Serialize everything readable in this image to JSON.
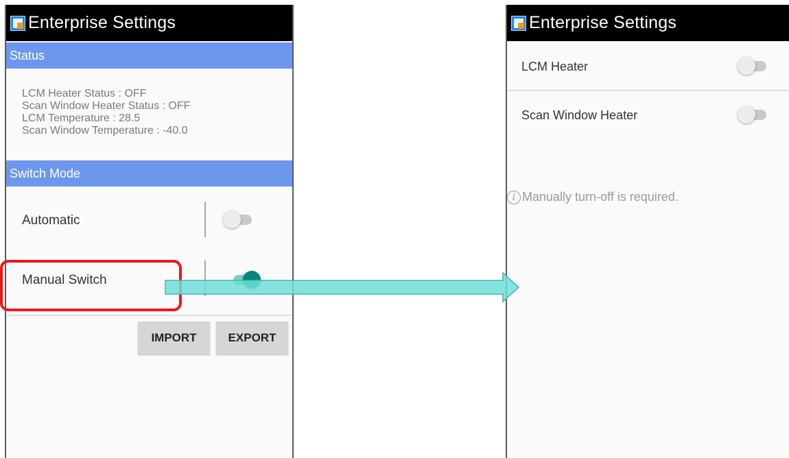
{
  "left_screen": {
    "title": "Enterprise Settings",
    "app_icon": "enterprise-settings-icon",
    "status_header": "Status",
    "status_lines": [
      "LCM Heater Status : OFF",
      "Scan Window Heater Status : OFF",
      "LCM Temperature : 28.5",
      "Scan Window Temperature : -40.0"
    ],
    "switch_mode_header": "Switch Mode",
    "automatic": {
      "label": "Automatic",
      "on": false
    },
    "manual_switch": {
      "label": "Manual Switch",
      "on": true
    },
    "buttons": {
      "import": "IMPORT",
      "export": "EXPORT"
    }
  },
  "right_screen": {
    "title": "Enterprise Settings",
    "app_icon": "enterprise-settings-icon",
    "lcm_heater": {
      "label": "LCM Heater",
      "on": false
    },
    "scan_window_heater": {
      "label": "Scan Window Heater",
      "on": false
    },
    "info_icon": "info-icon",
    "info_text": "Manually turn-off is required."
  },
  "colors": {
    "section_header": "#6d97ec",
    "toggle_on": "#00897b",
    "highlight": "#e8191c",
    "arrow": "#6fded8"
  }
}
